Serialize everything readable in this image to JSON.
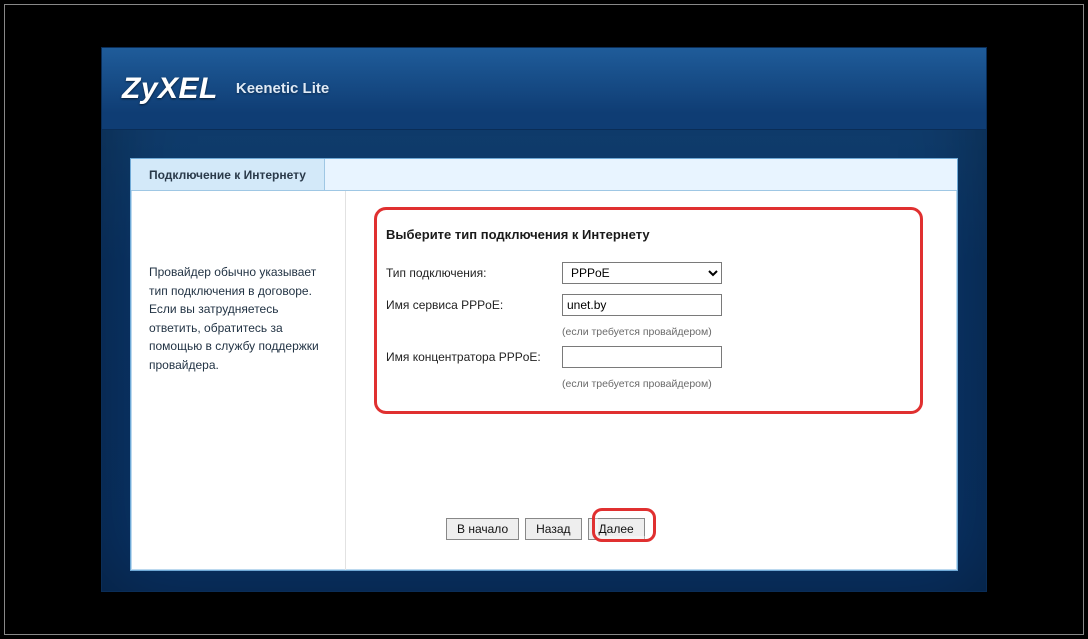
{
  "header": {
    "brand": "ZyXEL",
    "model": "Keenetic Lite"
  },
  "tabs": {
    "active": "Подключение к Интернету"
  },
  "sidebar": {
    "help_text": "Провайдер обычно указывает тип подключения в договоре. Если вы затрудняетесь ответить, обратитесь за помощью в службу поддержки провайдера."
  },
  "form": {
    "title": "Выберите тип подключения к Интернету",
    "conn_type": {
      "label": "Тип подключения:",
      "value": "PPPoE"
    },
    "pppoe_service": {
      "label": "Имя сервиса PPPoE:",
      "value": "unet.by",
      "hint": "(если требуется провайдером)"
    },
    "pppoe_ac": {
      "label": "Имя концентратора PPPoE:",
      "value": "",
      "hint": "(если требуется провайдером)"
    }
  },
  "footer": {
    "home": "В начало",
    "back": "Назад",
    "next": "Далее"
  }
}
